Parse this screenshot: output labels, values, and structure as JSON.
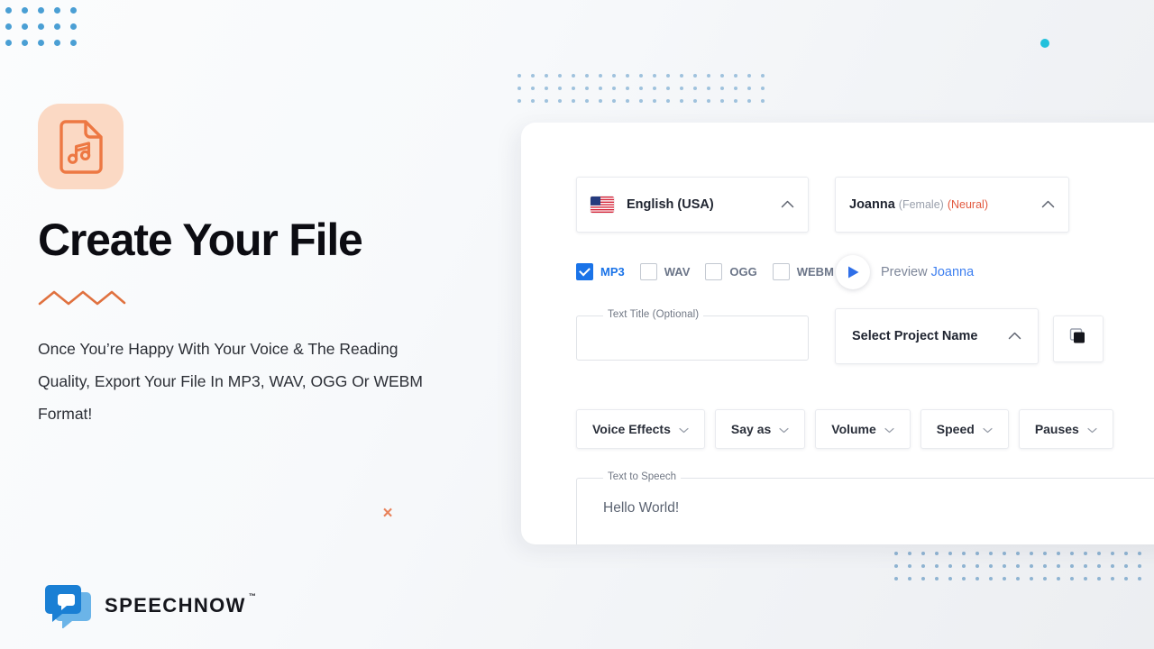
{
  "hero": {
    "icon_name": "audio-file-icon",
    "title": "Create Your File",
    "description": "Once You’re Happy With Your Voice & The Reading Quality, Export Your File In MP3, WAV, OGG Or WEBM Format!"
  },
  "brand": {
    "name": "SPEECHNOW",
    "trademark": "™"
  },
  "decor": {
    "close_mark": "×"
  },
  "app": {
    "language": {
      "label": "English (USA)",
      "flag": "us-flag-icon",
      "chevron": "chevron-up-icon"
    },
    "voice": {
      "name": "Joanna",
      "gender": "(Female)",
      "engine": "(Neural)",
      "chevron": "chevron-up-icon"
    },
    "formats": [
      {
        "label": "MP3",
        "checked": true
      },
      {
        "label": "WAV",
        "checked": false
      },
      {
        "label": "OGG",
        "checked": false
      },
      {
        "label": "WEBM",
        "checked": false
      }
    ],
    "preview": {
      "icon": "play-icon",
      "prefix": "Preview",
      "voice": "Joanna"
    },
    "text_title": {
      "legend": "Text Title (Optional)",
      "value": ""
    },
    "project": {
      "label": "Select Project Name",
      "chevron": "chevron-up-icon"
    },
    "copy_button": {
      "icon": "copy-icon"
    },
    "tools": [
      {
        "label": "Voice Effects"
      },
      {
        "label": "Say as"
      },
      {
        "label": "Volume"
      },
      {
        "label": "Speed"
      },
      {
        "label": "Pauses"
      }
    ],
    "text_to_speech": {
      "legend": "Text to Speech",
      "value": "Hello World!"
    }
  },
  "colors": {
    "accent_orange": "#ed7843",
    "accent_blue": "#1a73e8",
    "brand_blue": "#2f6fd0",
    "teal": "#22c1dc",
    "neural_red": "#e2593f"
  }
}
